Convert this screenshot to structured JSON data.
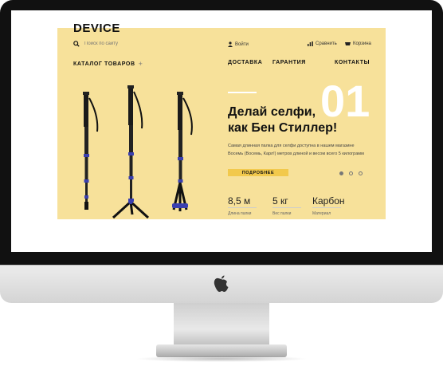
{
  "site": {
    "logo": "DEVICE",
    "search_placeholder": "Поиск по сайту",
    "login": "Войти",
    "compare": "Сравнить",
    "cart": "Корзина",
    "catalog": "КАТАЛОГ ТОВАРОВ",
    "catalog_plus": "+",
    "nav": [
      "ДОСТАВКА",
      "ГАРАНТИЯ",
      "КОНТАКТЫ"
    ]
  },
  "slide": {
    "number": "01",
    "title_line1": "Делай селфи,",
    "title_line2": "как Бен Стиллер!",
    "desc_line1": "Самая длинная палка для селфи доступна в нашем магазине",
    "desc_line2": "Восемь (Восемь, Карл!) метров длиной и весом всего 5 килограмм",
    "more": "ПОДРОБНЕЕ",
    "active_dot": 1,
    "dot_count": 3
  },
  "stats": [
    {
      "value": "8,5 м",
      "label": "Длина палки"
    },
    {
      "value": "5 кг",
      "label": "Вес палки"
    },
    {
      "value": "Карбон",
      "label": "Материал"
    }
  ],
  "colors": {
    "accent": "#f2c94c",
    "panel": "#f7e19a",
    "bezel": "#111111",
    "stick_blue": "#3a3fb0"
  },
  "icons": [
    "search-icon",
    "user-icon",
    "compare-icon",
    "cart-icon",
    "apple-logo-icon"
  ]
}
